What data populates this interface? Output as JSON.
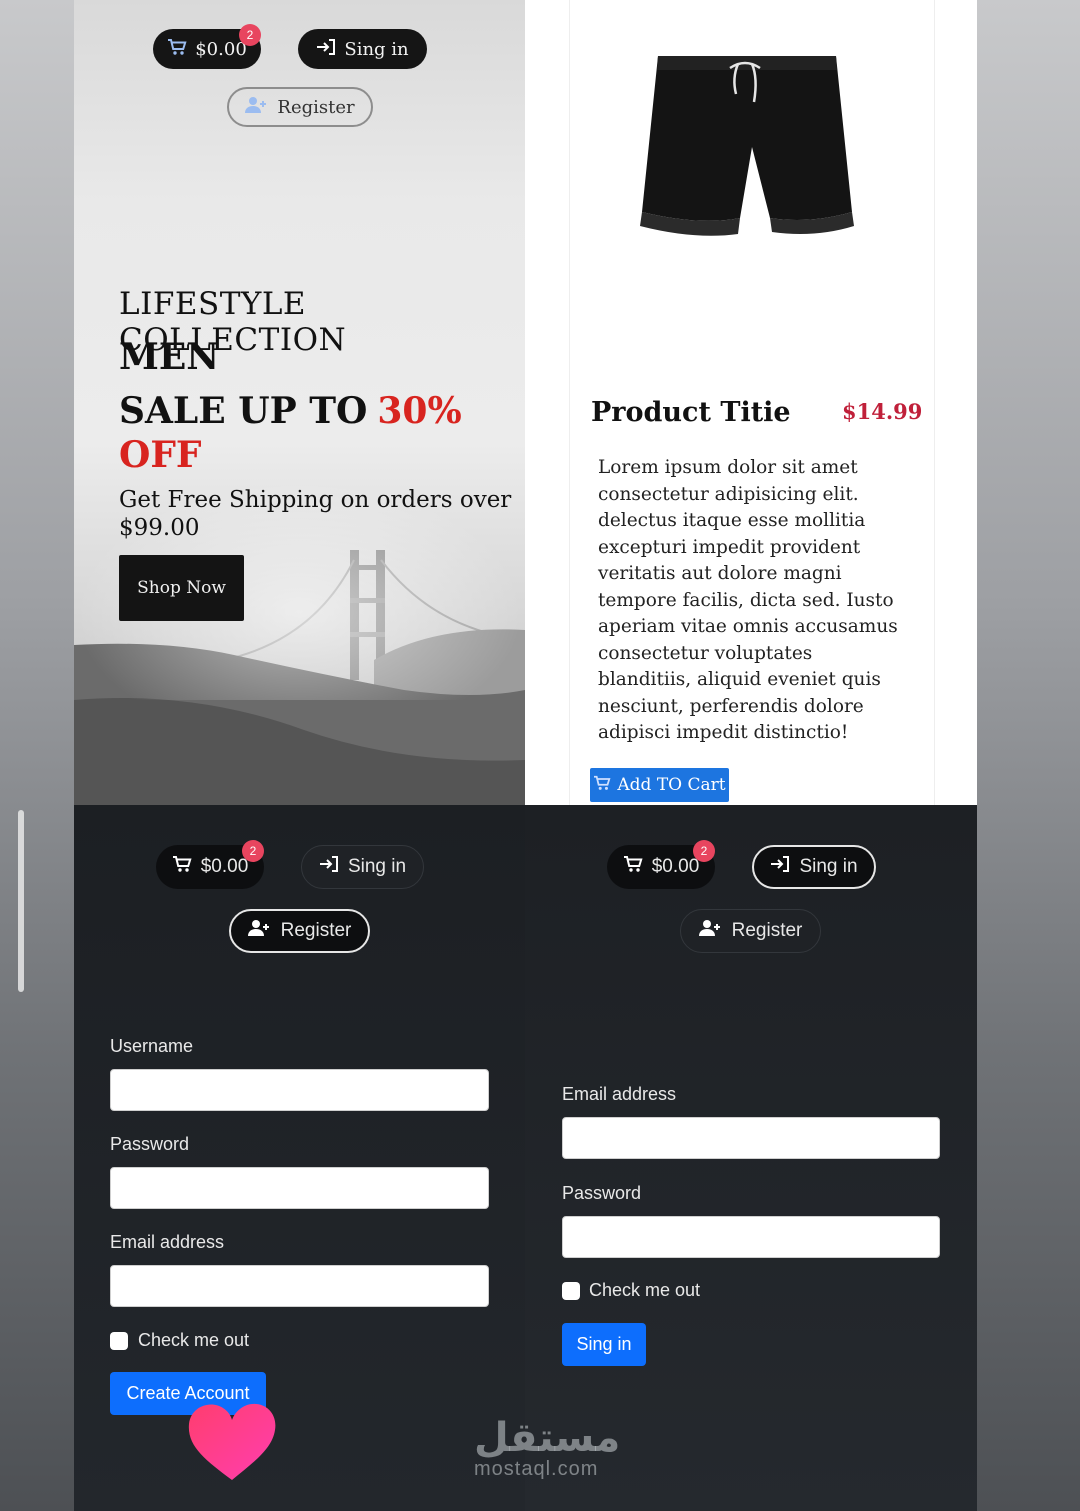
{
  "hero": {
    "cart_total": "$0.00",
    "cart_count": "2",
    "signin_label": "Sing in",
    "register_label": "Register",
    "collection_text": "LIFESTYLE COLLECTION",
    "men_text": "MEN",
    "sale_text": "SALE UP TO",
    "sale_percent": "30%",
    "off_text": "OFF",
    "shipping_text": "Get Free Shipping on orders over $99.00",
    "shop_button": "Shop Now"
  },
  "product": {
    "title": "Product Titie",
    "price": "$14.99",
    "description": "Lorem ipsum dolor sit amet consectetur adipisicing elit. delectus itaque esse mollitia excepturi impedit provident veritatis aut dolore magni tempore facilis, dicta sed. Iusto aperiam vitae omnis accusamus consectetur voluptates blanditiis, aliquid eveniet quis nesciunt, perferendis dolore adipisci impedit distinctio!",
    "add_button": "Add TO Cart"
  },
  "register_panel": {
    "cart_total": "$0.00",
    "cart_count": "2",
    "signin_label": "Sing in",
    "register_label": "Register",
    "username_label": "Username",
    "password_label": "Password",
    "email_label": "Email address",
    "check_label": "Check me out",
    "submit_button": "Create Account"
  },
  "signin_panel": {
    "cart_total": "$0.00",
    "cart_count": "2",
    "signin_label": "Sing in",
    "register_label": "Register",
    "email_label": "Email address",
    "password_label": "Password",
    "check_label": "Check me out",
    "submit_button": "Sing in"
  },
  "watermark": {
    "arabic": "مستقل",
    "latin": "mostaql.com"
  },
  "colors": {
    "accent_red": "#d8241f",
    "price_red": "#c0203a",
    "primary_blue": "#0d6efd",
    "badge_pink": "#e8455f",
    "heart_pink": "#ff3d8b"
  },
  "icons": [
    "cart-icon",
    "sign-in-icon",
    "add-user-icon",
    "heart-icon",
    "shorts-image"
  ]
}
